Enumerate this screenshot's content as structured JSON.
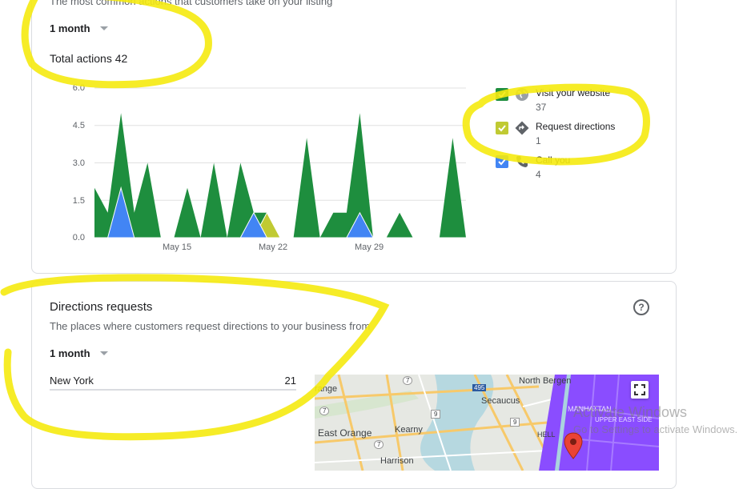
{
  "actions_card": {
    "subtitle": "The most common actions that customers take on your listing",
    "period_dropdown": "1 month",
    "total_actions": "Total actions 42"
  },
  "chart_data": {
    "type": "area",
    "title": "",
    "xlabel": "",
    "ylabel": "",
    "ylim": [
      0,
      6
    ],
    "y_ticks": [
      "6.0",
      "4.5",
      "3.0",
      "1.5",
      "0.0"
    ],
    "x_tick_labels": [
      "May 15",
      "May 22",
      "May 29"
    ],
    "x": [
      1,
      2,
      3,
      4,
      5,
      6,
      7,
      8,
      9,
      10,
      11,
      12,
      13,
      14,
      15,
      16,
      17,
      18,
      19,
      20,
      21,
      22,
      23,
      24,
      25,
      26,
      27,
      28,
      29
    ],
    "series": [
      {
        "name": "Visit your website",
        "color": "#1e8e3e",
        "values": [
          2,
          1,
          5,
          1,
          3,
          0,
          0,
          2,
          0,
          3,
          0,
          3,
          1,
          1,
          0,
          0,
          4,
          0,
          1,
          1,
          5,
          0,
          0,
          1,
          0,
          0,
          0,
          4,
          0
        ]
      },
      {
        "name": "Request directions",
        "color": "#c0ca33",
        "values": [
          0,
          0,
          0,
          0,
          0,
          0,
          0,
          0,
          0,
          0,
          0,
          0,
          0,
          1,
          0,
          0,
          0,
          0,
          0,
          0,
          0,
          0,
          0,
          0,
          0,
          0,
          0,
          0,
          0
        ]
      },
      {
        "name": "Call you",
        "color": "#4285f4",
        "values": [
          0,
          0,
          2,
          0,
          0,
          0,
          0,
          0,
          0,
          0,
          0,
          0,
          1,
          0,
          0,
          0,
          0,
          0,
          0,
          0,
          1,
          0,
          0,
          0,
          0,
          0,
          0,
          0,
          0
        ]
      }
    ],
    "grid": true,
    "legend_position": "right"
  },
  "legend": [
    {
      "label": "Visit your website",
      "count": "37",
      "color": "#1e8e3e",
      "icon": "globe-icon"
    },
    {
      "label": "Request directions",
      "count": "1",
      "color": "#c0ca33",
      "icon": "directions-icon"
    },
    {
      "label": "Call you",
      "count": "4",
      "color": "#4285f4",
      "icon": "phone-icon"
    }
  ],
  "directions_card": {
    "title": "Directions requests",
    "subtitle": "The places where customers request directions to your business from",
    "period_dropdown": "1 month",
    "help_icon": "?",
    "places": [
      {
        "name": "New York",
        "count": "21"
      }
    ]
  },
  "map": {
    "labels": [
      "North Bergen",
      "Secaucus",
      "East Orange",
      "Kearny",
      "Harrison",
      "range",
      "MANHATTAN",
      "UPPER EAST SIDE",
      "HELL"
    ],
    "road_shields": [
      "7",
      "495",
      "9",
      "7",
      "9",
      "7"
    ]
  },
  "watermark": {
    "title": "Activate Windows",
    "subtitle": "Go to Settings to activate Windows."
  }
}
